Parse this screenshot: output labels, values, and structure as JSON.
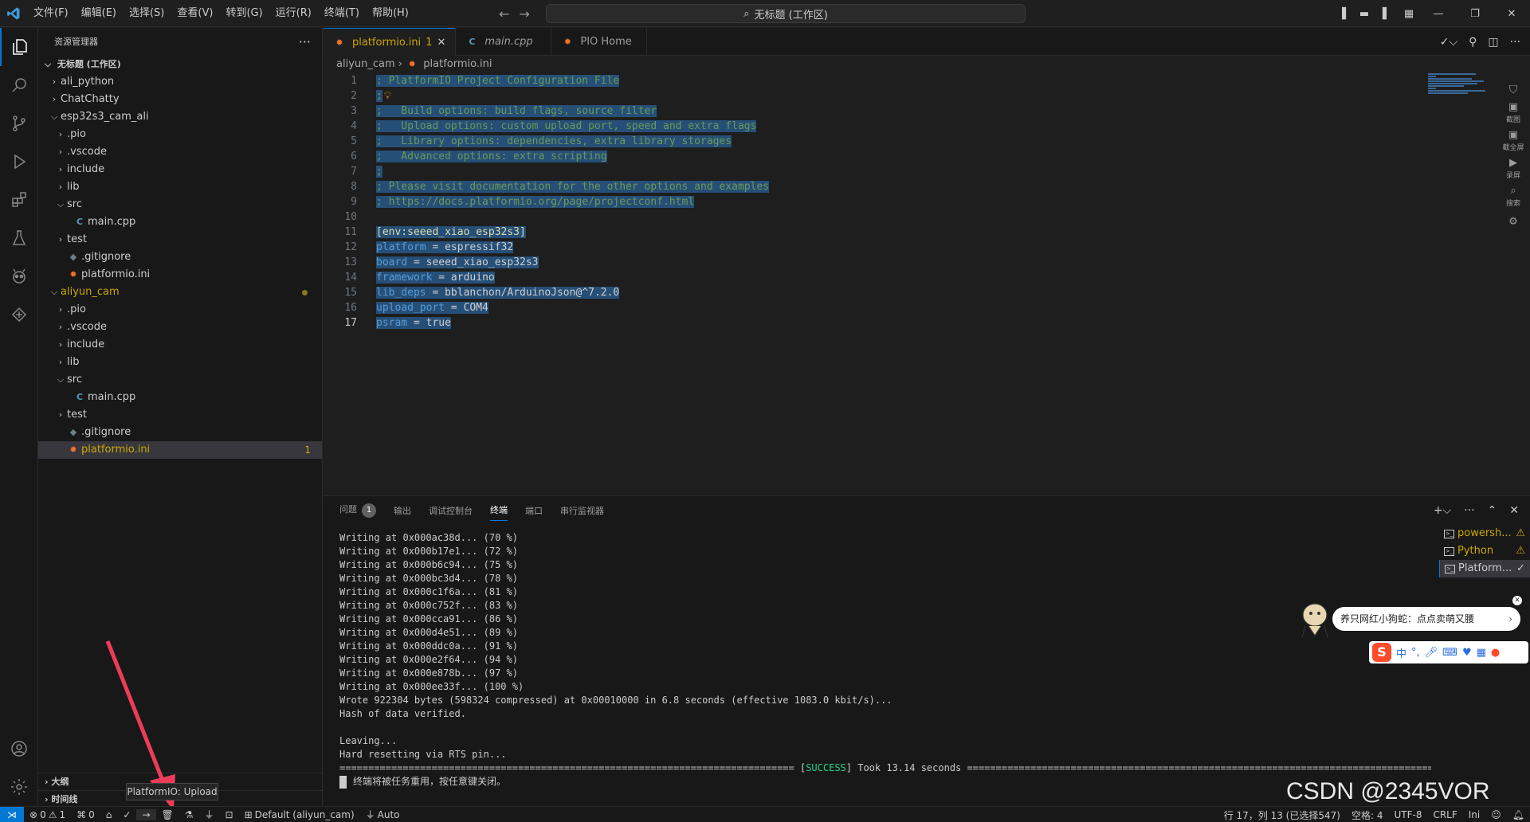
{
  "titlebar": {
    "menus": [
      "文件(F)",
      "编辑(E)",
      "选择(S)",
      "查看(V)",
      "转到(G)",
      "运行(R)",
      "终端(T)",
      "帮助(H)"
    ],
    "search_text": "无标题 (工作区)"
  },
  "sidebar": {
    "title": "资源管理器",
    "workspace": "无标题 (工作区)",
    "tree": [
      {
        "label": "ali_python",
        "indent": 1,
        "type": "folder",
        "open": false
      },
      {
        "label": "ChatChatty",
        "indent": 1,
        "type": "folder",
        "open": false
      },
      {
        "label": "esp32s3_cam_ali",
        "indent": 1,
        "type": "folder",
        "open": true
      },
      {
        "label": ".pio",
        "indent": 2,
        "type": "folder",
        "open": false
      },
      {
        "label": ".vscode",
        "indent": 2,
        "type": "folder",
        "open": false
      },
      {
        "label": "include",
        "indent": 2,
        "type": "folder",
        "open": false
      },
      {
        "label": "lib",
        "indent": 2,
        "type": "folder",
        "open": false
      },
      {
        "label": "src",
        "indent": 2,
        "type": "folder",
        "open": true
      },
      {
        "label": "main.cpp",
        "indent": 3,
        "type": "cpp"
      },
      {
        "label": "test",
        "indent": 2,
        "type": "folder",
        "open": false
      },
      {
        "label": ".gitignore",
        "indent": 2,
        "type": "git"
      },
      {
        "label": "platformio.ini",
        "indent": 2,
        "type": "ini"
      },
      {
        "label": "aliyun_cam",
        "indent": 1,
        "type": "folder",
        "open": true,
        "modified": true
      },
      {
        "label": ".pio",
        "indent": 2,
        "type": "folder",
        "open": false
      },
      {
        "label": ".vscode",
        "indent": 2,
        "type": "folder",
        "open": false
      },
      {
        "label": "include",
        "indent": 2,
        "type": "folder",
        "open": false
      },
      {
        "label": "lib",
        "indent": 2,
        "type": "folder",
        "open": false
      },
      {
        "label": "src",
        "indent": 2,
        "type": "folder",
        "open": true
      },
      {
        "label": "main.cpp",
        "indent": 3,
        "type": "cpp"
      },
      {
        "label": "test",
        "indent": 2,
        "type": "folder",
        "open": false
      },
      {
        "label": ".gitignore",
        "indent": 2,
        "type": "git"
      },
      {
        "label": "platformio.ini",
        "indent": 2,
        "type": "ini",
        "selected": true,
        "badge": "1"
      }
    ],
    "outline": "大纲",
    "timeline": "时间线"
  },
  "tabs": [
    {
      "label": "platformio.ini",
      "badge": "1",
      "active": true,
      "icon": "platformio-icon"
    },
    {
      "label": "main.cpp",
      "active": false,
      "icon": "cpp-icon"
    },
    {
      "label": "PIO Home",
      "active": false,
      "icon": "platformio-icon"
    }
  ],
  "breadcrumb": {
    "folder": "aliyun_cam",
    "file": "platformio.ini"
  },
  "code": [
    {
      "n": "1",
      "parts": [
        {
          "c": "com",
          "t": "; PlatformIO Project Configuration File"
        }
      ]
    },
    {
      "n": "2",
      "parts": [
        {
          "c": "com",
          "t": ";"
        }
      ]
    },
    {
      "n": "3",
      "parts": [
        {
          "c": "com",
          "t": ";   Build options: build flags, source filter"
        }
      ]
    },
    {
      "n": "4",
      "parts": [
        {
          "c": "com",
          "t": ";   Upload options: custom upload port, speed and extra flags"
        }
      ]
    },
    {
      "n": "5",
      "parts": [
        {
          "c": "com",
          "t": ";   Library options: dependencies, extra library storages"
        }
      ]
    },
    {
      "n": "6",
      "parts": [
        {
          "c": "com",
          "t": ";   Advanced options: extra scripting"
        }
      ]
    },
    {
      "n": "7",
      "parts": [
        {
          "c": "com",
          "t": ";"
        }
      ]
    },
    {
      "n": "8",
      "parts": [
        {
          "c": "com",
          "t": "; Please visit documentation for the other options and examples"
        }
      ]
    },
    {
      "n": "9",
      "parts": [
        {
          "c": "com",
          "t": "; https://docs.platformio.org/page/projectconf.html"
        }
      ]
    },
    {
      "n": "10",
      "parts": []
    },
    {
      "n": "11",
      "parts": [
        {
          "c": "sec",
          "t": "[env:seeed_xiao_esp32s3]"
        }
      ]
    },
    {
      "n": "12",
      "parts": [
        {
          "c": "key",
          "t": "platform"
        },
        {
          "c": "val",
          "t": " = espressif32"
        }
      ]
    },
    {
      "n": "13",
      "parts": [
        {
          "c": "key",
          "t": "board"
        },
        {
          "c": "val",
          "t": " = seeed_xiao_esp32s3"
        }
      ]
    },
    {
      "n": "14",
      "parts": [
        {
          "c": "key",
          "t": "framework"
        },
        {
          "c": "val",
          "t": " = arduino"
        }
      ]
    },
    {
      "n": "15",
      "parts": [
        {
          "c": "key",
          "t": "lib_deps"
        },
        {
          "c": "val",
          "t": " = bblanchon/ArduinoJson@^7.2.0"
        }
      ]
    },
    {
      "n": "16",
      "parts": [
        {
          "c": "key",
          "t": "upload_port"
        },
        {
          "c": "val",
          "t": " = COM4"
        }
      ]
    },
    {
      "n": "17",
      "parts": [
        {
          "c": "key",
          "t": "psram"
        },
        {
          "c": "val",
          "t": " = true"
        }
      ],
      "current": true
    }
  ],
  "right_tools": [
    "截图",
    "截全屏",
    "录屏",
    "搜索"
  ],
  "panel": {
    "tabs": [
      "问题",
      "输出",
      "调试控制台",
      "终端",
      "端口",
      "串行监视器"
    ],
    "problems_count": "1",
    "active_tab": "终端",
    "terminal_lines": [
      "Writing at 0x000ac38d... (70 %)",
      "Writing at 0x000b17e1... (72 %)",
      "Writing at 0x000b6c94... (75 %)",
      "Writing at 0x000bc3d4... (78 %)",
      "Writing at 0x000c1f6a... (81 %)",
      "Writing at 0x000c752f... (83 %)",
      "Writing at 0x000cca91... (86 %)",
      "Writing at 0x000d4e51... (89 %)",
      "Writing at 0x000ddc0a... (91 %)",
      "Writing at 0x000e2f64... (94 %)",
      "Writing at 0x000e878b... (97 %)",
      "Writing at 0x000ee33f... (100 %)",
      "Wrote 922304 bytes (598324 compressed) at 0x00010000 in 6.8 seconds (effective 1083.0 kbit/s)...",
      "Hash of data verified.",
      "",
      "Leaving...",
      "Hard resetting via RTS pin..."
    ],
    "success_left": "=============================================================================== [",
    "success_word": "SUCCESS",
    "success_right": "] Took 13.14 seconds ====================================================================================================",
    "reuse_msg": "终端将被任务重用，按任意键关闭。",
    "terminals": [
      {
        "label": "powersh...",
        "status": "warn"
      },
      {
        "label": "Python",
        "status": "warn"
      },
      {
        "label": "Platform...",
        "status": "ok",
        "selected": true
      }
    ]
  },
  "notification": "养只网红小狗蛇：点点卖萌又腰",
  "ime": {
    "logo": "S",
    "mode": "中"
  },
  "watermark": "CSDN @2345VOR",
  "tooltip": "PlatformIO: Upload",
  "statusbar": {
    "errors": "0",
    "warnings": "1",
    "ports": "0",
    "env": "Default (aliyun_cam)",
    "port_mode": "Auto",
    "position": "行 17，列 13 (已选择547)",
    "spaces": "空格: 4",
    "encoding": "UTF-8",
    "eol": "CRLF",
    "language": "Ini"
  },
  "colors": {
    "accent": "#0078d4",
    "success": "#23d18b",
    "warning": "#cca700",
    "ini_icon": "#f5722c"
  }
}
